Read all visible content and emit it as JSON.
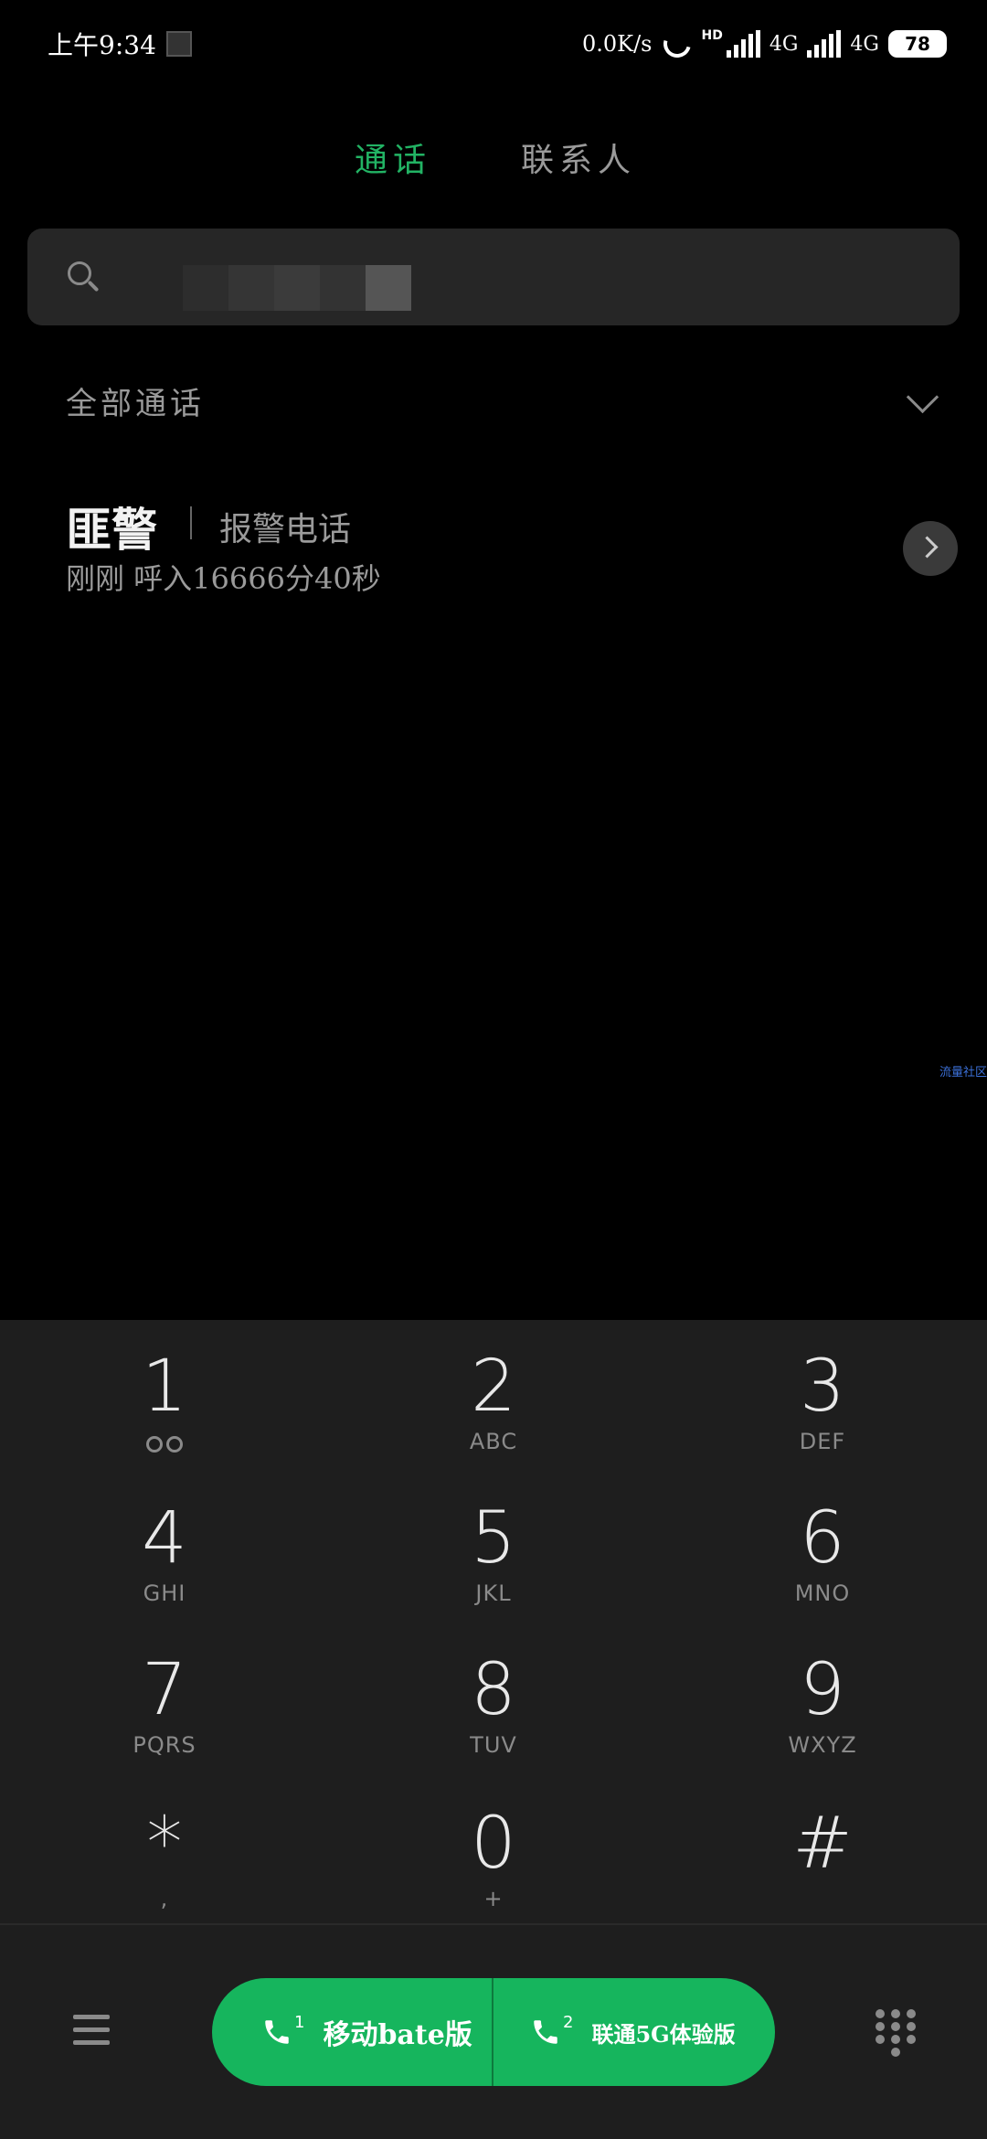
{
  "status_bar": {
    "time": "上午9:34",
    "net_speed": "0.0K/s",
    "hd_label": "HD",
    "network_1": "4G",
    "network_2": "4G",
    "battery": "78"
  },
  "tabs": [
    {
      "label": "通话",
      "active": true
    },
    {
      "label": "联系人",
      "active": false
    }
  ],
  "search": {
    "placeholder": ""
  },
  "filter": {
    "label": "全部通话"
  },
  "calls": [
    {
      "name": "匪警",
      "tag": "报警电话",
      "detail": "刚刚 呼入16666分40秒"
    }
  ],
  "watermark": "流量社区",
  "keypad": [
    {
      "digit": "1",
      "letters": ""
    },
    {
      "digit": "2",
      "letters": "ABC"
    },
    {
      "digit": "3",
      "letters": "DEF"
    },
    {
      "digit": "4",
      "letters": "GHI"
    },
    {
      "digit": "5",
      "letters": "JKL"
    },
    {
      "digit": "6",
      "letters": "MNO"
    },
    {
      "digit": "7",
      "letters": "PQRS"
    },
    {
      "digit": "8",
      "letters": "TUV"
    },
    {
      "digit": "9",
      "letters": "WXYZ"
    },
    {
      "digit": "*",
      "letters": ","
    },
    {
      "digit": "0",
      "letters": "+"
    },
    {
      "digit": "#",
      "letters": ""
    }
  ],
  "dial_buttons": [
    {
      "sim": "1",
      "label": "移动bate版"
    },
    {
      "sim": "2",
      "label": "联通5G体验版"
    }
  ],
  "colors": {
    "accent": "#16b55d",
    "background": "#000000",
    "keypad_bg": "#1e1e1e"
  }
}
